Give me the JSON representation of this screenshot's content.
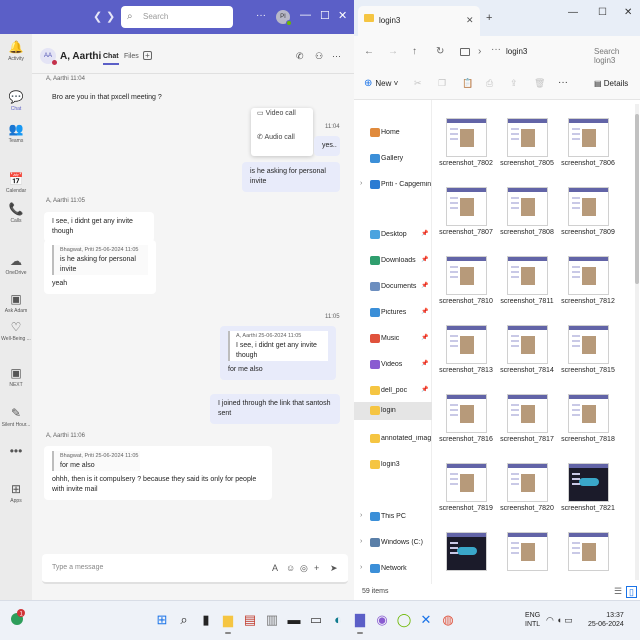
{
  "teams": {
    "search_placeholder": "Search",
    "avatar_initials": "PI",
    "rail": [
      {
        "icon": "bell-icon",
        "glyph": "🔔",
        "label": "Activity"
      },
      {
        "icon": "chat-icon",
        "glyph": "💬",
        "label": "Chat",
        "active": true
      },
      {
        "icon": "teams-icon",
        "glyph": "👥",
        "label": "Teams"
      },
      {
        "icon": "calendar-icon",
        "glyph": "📅",
        "label": "Calendar"
      },
      {
        "icon": "phone-icon",
        "glyph": "📞",
        "label": "Calls"
      },
      {
        "icon": "onedrive-icon",
        "glyph": "☁",
        "label": "OneDrive"
      },
      {
        "icon": "ask-adam-icon",
        "glyph": "▣",
        "label": "Ask Adam"
      },
      {
        "icon": "wellbeing-icon",
        "glyph": "♡",
        "label": "Well-Being ..."
      },
      {
        "icon": "next-icon",
        "glyph": "▣",
        "label": "NEXT"
      },
      {
        "icon": "silent-hour-icon",
        "glyph": "✎",
        "label": "Silent Hour..."
      },
      {
        "icon": "more-apps-icon",
        "glyph": "•••",
        "label": ""
      },
      {
        "icon": "apps-icon",
        "glyph": "⊞",
        "label": "Apps"
      }
    ],
    "chat_header": {
      "initials": "AA",
      "name": "A, Aarthi",
      "tab_chat": "Chat",
      "tab_files": "Files"
    },
    "call_menu": {
      "video": "Video call",
      "audio": "Audio call"
    },
    "messages": {
      "m1_meta": "A, Aarthi  11:04",
      "m1_text": "Bro are you in that pxcell meeting ?",
      "m2_time": "11:04",
      "m2_text": "yes..",
      "m3_text": "is he asking for personal invite",
      "m4_meta": "A, Aarthi  11:05",
      "m4_text": "I see, i didnt get any invite though",
      "m5_quote_meta": "Bhagwat, Priti  25-06-2024 11:05",
      "m5_quote_text": "is he asking for personal invite",
      "m5_text": "yeah",
      "m6_time": "11:05",
      "m6_quote_meta": "A, Aarthi  25-06-2024 11:05",
      "m6_quote_text": "I see, i didnt get any invite though",
      "m6_text": "for me also",
      "m7_text": "I joined through the link that santosh sent",
      "m8_meta": "A, Aarthi  11:06",
      "m8_quote_meta": "Bhagwat, Priti  25-06-2024 11:05",
      "m8_quote_text": "for me also",
      "m8_text": "ohhh, then is it compulsery ? because they said its only for people with invite mail"
    },
    "compose_placeholder": "Type a message"
  },
  "explorer": {
    "tab_title": "login3",
    "path": "login3",
    "search_placeholder": "Search login3",
    "new_label": "New",
    "details_label": "Details",
    "nav": [
      {
        "label": "Home",
        "icon": "home-icon",
        "color": "#e08a3c"
      },
      {
        "label": "Gallery",
        "icon": "gallery-icon",
        "color": "#3b8fd8"
      },
      {
        "label": "Priti - Capgemini",
        "icon": "onedrive-icon",
        "color": "#2b7cd3",
        "chev": true
      },
      {
        "label": "Desktop",
        "icon": "desktop-icon",
        "color": "#4aa3df",
        "pin": true
      },
      {
        "label": "Downloads",
        "icon": "downloads-icon",
        "color": "#2f9e6e",
        "pin": true
      },
      {
        "label": "Documents",
        "icon": "documents-icon",
        "color": "#6c8ebf",
        "pin": true
      },
      {
        "label": "Pictures",
        "icon": "pictures-icon",
        "color": "#3b8fd8",
        "pin": true
      },
      {
        "label": "Music",
        "icon": "music-icon",
        "color": "#e0523c",
        "pin": true
      },
      {
        "label": "Videos",
        "icon": "videos-icon",
        "color": "#8a5cd1",
        "pin": true
      },
      {
        "label": "dell_poc",
        "icon": "folder-icon",
        "color": "#f5c542",
        "pin": true
      },
      {
        "label": "login",
        "icon": "folder-icon",
        "color": "#f5c542",
        "selected": true
      },
      {
        "label": "annotated_images",
        "icon": "folder-icon",
        "color": "#f5c542"
      },
      {
        "label": "login3",
        "icon": "folder-icon",
        "color": "#f5c542"
      },
      {
        "label": "This PC",
        "icon": "this-pc-icon",
        "color": "#3b8fd8",
        "chev": true
      },
      {
        "label": "Windows (C:)",
        "icon": "drive-icon",
        "color": "#5a7fa8",
        "chev": true
      },
      {
        "label": "Network",
        "icon": "network-icon",
        "color": "#3b8fd8",
        "chev": true
      }
    ],
    "files": [
      "screenshot_7802",
      "screenshot_7805",
      "screenshot_7806",
      "screenshot_7807",
      "screenshot_7808",
      "screenshot_7809",
      "screenshot_7810",
      "screenshot_7811",
      "screenshot_7812",
      "screenshot_7813",
      "screenshot_7814",
      "screenshot_7815",
      "screenshot_7816",
      "screenshot_7817",
      "screenshot_7818",
      "screenshot_7819",
      "screenshot_7820",
      "screenshot_7821",
      "",
      "",
      ""
    ],
    "status_count": "59 items"
  },
  "taskbar": {
    "lang_top": "ENG",
    "lang_bottom": "INTL",
    "time": "13:37",
    "date": "25-06-2024"
  }
}
